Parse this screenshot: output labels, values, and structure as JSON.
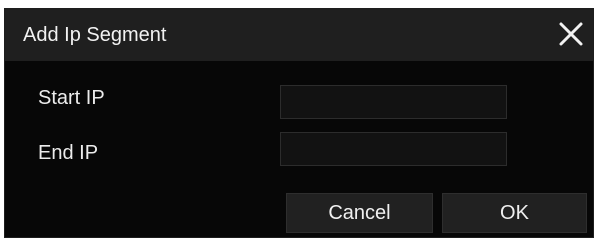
{
  "dialog": {
    "title": "Add Ip Segment",
    "close_icon": "close-icon",
    "fields": {
      "start_ip": {
        "label": "Start IP",
        "value": "",
        "placeholder": ""
      },
      "end_ip": {
        "label": "End IP",
        "value": "",
        "placeholder": ""
      }
    },
    "buttons": {
      "cancel_label": "Cancel",
      "ok_label": "OK"
    }
  },
  "colors": {
    "background": "#070707",
    "titlebar": "#1f1f1f",
    "button": "#212121",
    "input": "#121212",
    "text": "#f0f0f0"
  }
}
